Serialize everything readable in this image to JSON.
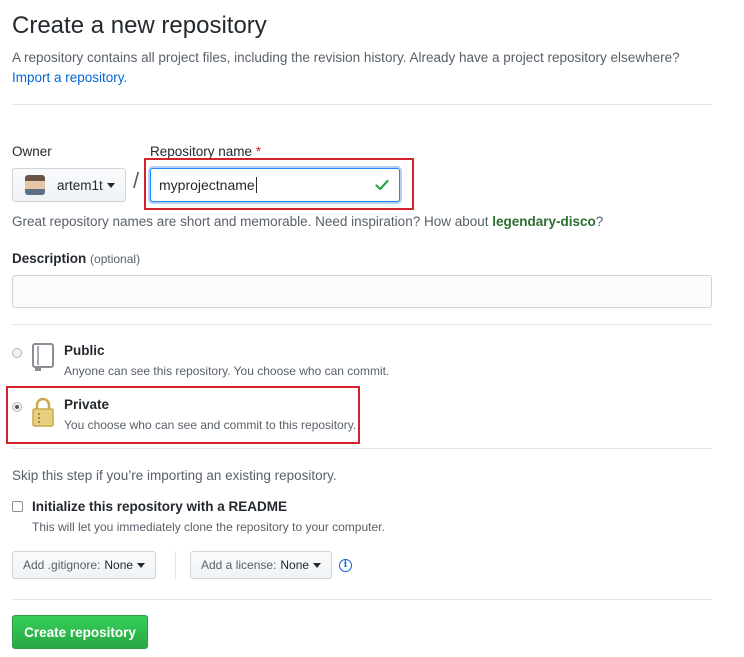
{
  "header": {
    "title": "Create a new repository",
    "subtitle": "A repository contains all project files, including the revision history. Already have a project repository elsewhere?",
    "import_link": "Import a repository."
  },
  "owner": {
    "label": "Owner",
    "value": "artem1t"
  },
  "separator": "/",
  "repo_name": {
    "label": "Repository name",
    "required_mark": "*",
    "value": "myprojectname",
    "valid_icon": "check-icon"
  },
  "name_hint": {
    "text": "Great repository names are short and memorable. Need inspiration? How about",
    "suggestion": "legendary-disco",
    "end": "?"
  },
  "description": {
    "label": "Description",
    "optional": "(optional)",
    "value": ""
  },
  "visibility": {
    "selected": "private",
    "public": {
      "title": "Public",
      "note": "Anyone can see this repository. You choose who can commit.",
      "icon": "repo-book-icon"
    },
    "private": {
      "title": "Private",
      "note": "You choose who can see and commit to this repository.",
      "icon": "lock-icon"
    }
  },
  "init": {
    "skip_note": "Skip this step if you’re importing an existing repository.",
    "readme_label": "Initialize this repository with a README",
    "readme_note": "This will let you immediately clone the repository to your computer.",
    "readme_checked": false
  },
  "gitignore": {
    "label": "Add .gitignore:",
    "value": "None"
  },
  "license": {
    "label": "Add a license:",
    "value": "None"
  },
  "submit": {
    "label": "Create repository"
  },
  "colors": {
    "link": "#0366d6",
    "primary_button": "#28a745",
    "highlight_box": "#d3222a",
    "lock_icon": "#c9a84f"
  }
}
